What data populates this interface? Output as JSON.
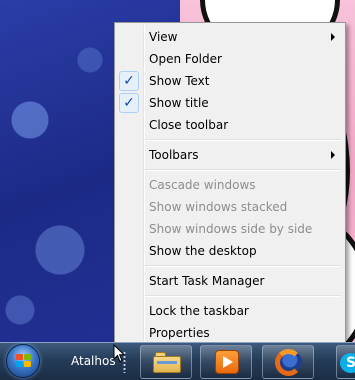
{
  "context_menu": {
    "items": [
      {
        "label": "View",
        "submenu": true
      },
      {
        "label": "Open Folder"
      },
      {
        "label": "Show Text",
        "checked": true
      },
      {
        "label": "Show title",
        "checked": true
      },
      {
        "label": "Close toolbar"
      },
      {
        "label": "Toolbars",
        "submenu": true
      },
      {
        "label": "Cascade windows",
        "disabled": true
      },
      {
        "label": "Show windows stacked",
        "disabled": true
      },
      {
        "label": "Show windows side by side",
        "disabled": true
      },
      {
        "label": "Show the desktop"
      },
      {
        "label": "Start Task Manager"
      },
      {
        "label": "Lock the taskbar"
      },
      {
        "label": "Properties"
      }
    ],
    "check_glyph": "✓"
  },
  "taskbar": {
    "toolbar_label": "Atalhos",
    "pinned_apps": [
      {
        "icon": "windows-explorer-icon"
      },
      {
        "icon": "media-player-icon"
      },
      {
        "icon": "firefox-icon"
      },
      {
        "icon": "skype-icon"
      }
    ],
    "skype_glyph": "S"
  },
  "colors": {
    "menu_background": "#f0f0f0",
    "menu_border": "#979797",
    "disabled_text": "#8d8d8d",
    "check_highlight": "#e6f0fa",
    "check_mark": "#1a47b8",
    "taskbar_top": "#3e5a7c",
    "taskbar_bottom": "#1b2d45"
  }
}
